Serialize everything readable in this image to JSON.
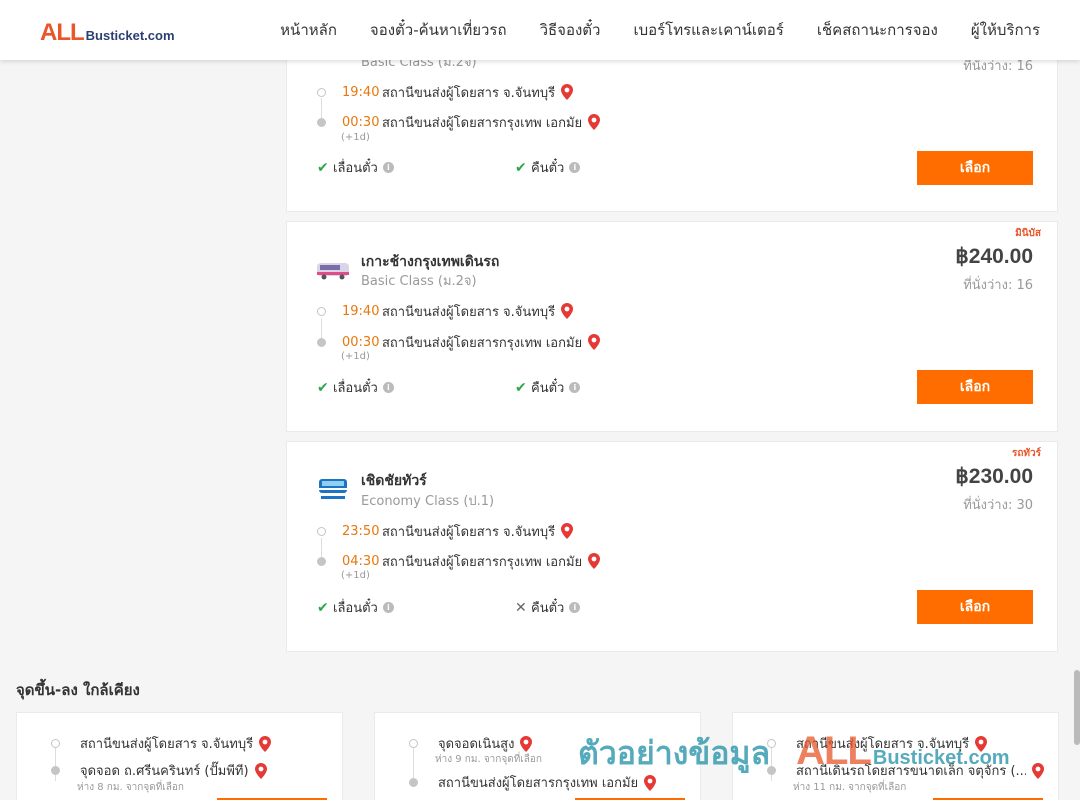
{
  "header": {
    "logo_all": "ALL",
    "logo_bus": "Busticket.com",
    "nav": [
      "หน้าหลัก",
      "จองตั๋ว-ค้นหาเที่ยวรถ",
      "วิธีจองตั๋ว",
      "เบอร์โทรและเคาน์เตอร์",
      "เช็คสถานะการจอง",
      "ผู้ให้บริการ"
    ]
  },
  "cards": [
    {
      "tag": "",
      "operator": "",
      "class": "Basic Class (ม.2จ)",
      "price": "",
      "seats": "ที่นั่งว่าง: 16",
      "depart_time": "19:40",
      "depart_station": "สถานีขนส่งผู้โดยสาร จ.จันทบุรี",
      "arrive_time": "00:30",
      "arrive_station": "สถานีขนส่งผู้โดยสารกรุงเทพ เอกมัย",
      "plus_day": "(+1d)",
      "reschedule": "เลื่อนตั๋ว",
      "refund": "คืนตั๋ว",
      "refund_ok": true,
      "select": "เลือก"
    },
    {
      "tag": "มินิบัส",
      "operator": "เกาะช้างกรุงเทพเดินรถ",
      "class": "Basic Class (ม.2จ)",
      "price": "฿240.00",
      "seats": "ที่นั่งว่าง: 16",
      "depart_time": "19:40",
      "depart_station": "สถานีขนส่งผู้โดยสาร จ.จันทบุรี",
      "arrive_time": "00:30",
      "arrive_station": "สถานีขนส่งผู้โดยสารกรุงเทพ เอกมัย",
      "plus_day": "(+1d)",
      "reschedule": "เลื่อนตั๋ว",
      "refund": "คืนตั๋ว",
      "refund_ok": true,
      "select": "เลือก"
    },
    {
      "tag": "รถทัวร์",
      "operator": "เชิดชัยทัวร์",
      "class": "Economy Class (ป.1)",
      "price": "฿230.00",
      "seats": "ที่นั่งว่าง: 30",
      "depart_time": "23:50",
      "depart_station": "สถานีขนส่งผู้โดยสาร จ.จันทบุรี",
      "arrive_time": "04:30",
      "arrive_station": "สถานีขนส่งผู้โดยสารกรุงเทพ เอกมัย",
      "plus_day": "(+1d)",
      "reschedule": "เลื่อนตั๋ว",
      "refund": "คืนตั๋ว",
      "refund_ok": false,
      "select": "เลือก"
    }
  ],
  "nearby": {
    "title": "จุดขึ้น-ลง ใกล้เคียง",
    "items": [
      {
        "from": "สถานีขนส่งผู้โดยสาร จ.จันทบุรี",
        "from_sub": "",
        "to": "จุดจอด ถ.ศรีนครินทร์ (ปั๊มพีที)",
        "to_sub": "ห่าง 8 กม. จากจุดที่เลือก"
      },
      {
        "from": "จุดจอดเนินสูง",
        "from_sub": "ห่าง 9 กม. จากจุดที่เลือก",
        "to": "สถานีขนส่งผู้โดยสารกรุงเทพ เอกมัย",
        "to_sub": ""
      },
      {
        "from": "สถานีขนส่งผู้โดยสาร จ.จันทบุรี",
        "from_sub": "",
        "to": "สถานีเดินรถโดยสารขนาดเล็ก จตุจักร (...",
        "to_sub": "ห่าง 11 กม. จากจุดที่เลือก"
      }
    ]
  },
  "watermark": {
    "text": "ตัวอย่างข้อมูล",
    "all": "ALL",
    "bus": "Busticket.com"
  },
  "colors": {
    "accent": "#ff6d00",
    "brand": "#e8562a",
    "time": "#e8770c",
    "ok": "#2aa84a"
  }
}
